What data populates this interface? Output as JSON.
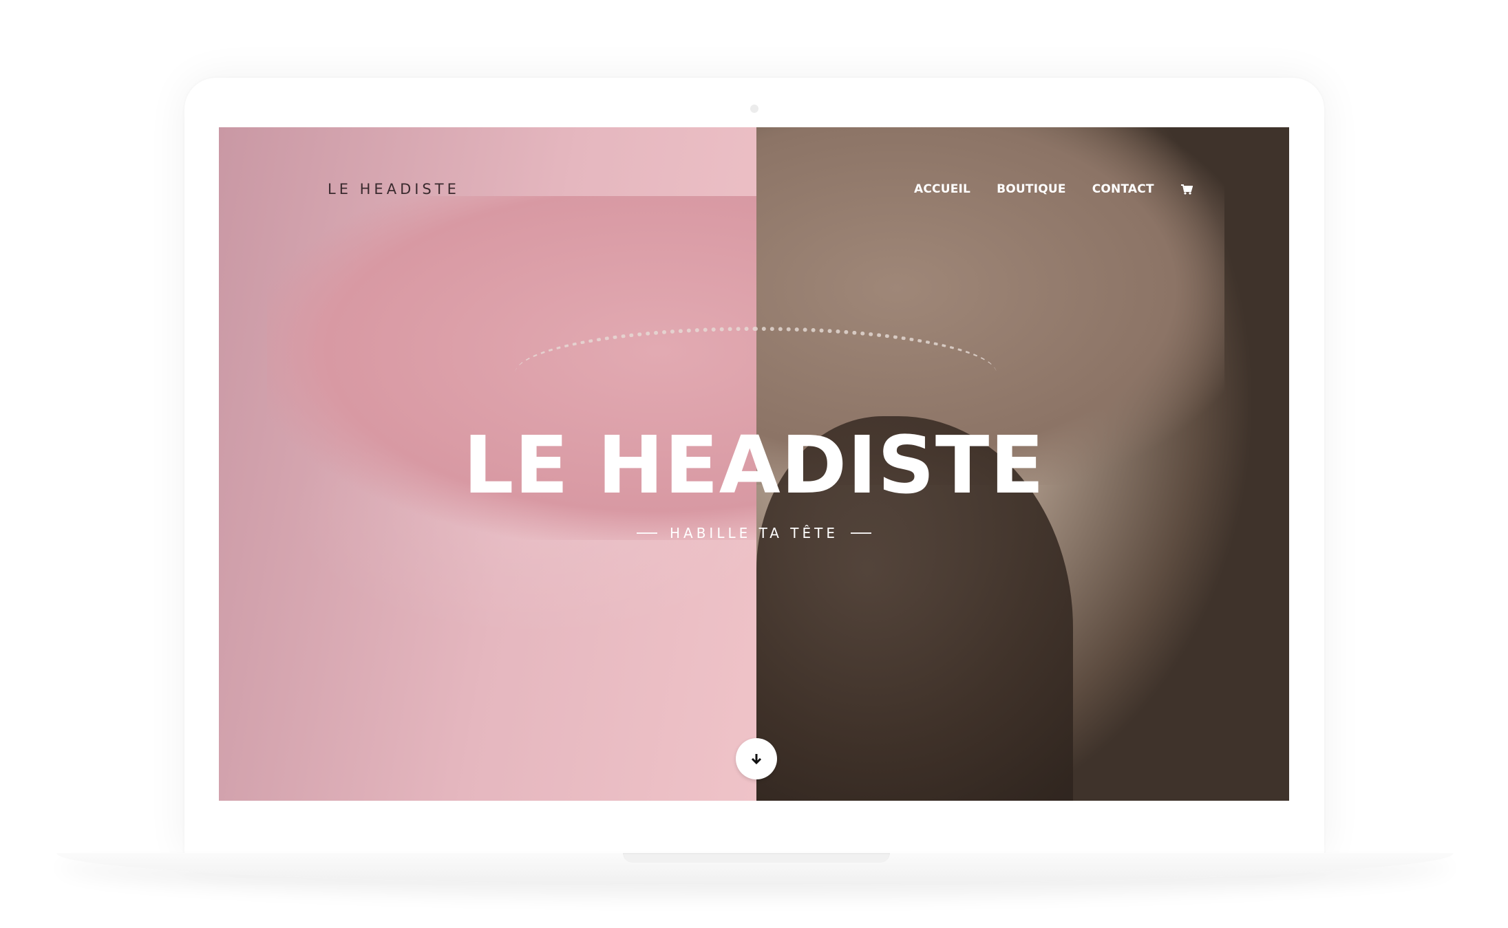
{
  "site": {
    "logo_text": "LE HEADISTE"
  },
  "nav": {
    "items": [
      {
        "label": "ACCUEIL"
      },
      {
        "label": "BOUTIQUE"
      },
      {
        "label": "CONTACT"
      }
    ],
    "cart_icon": "shopping-cart-icon"
  },
  "hero": {
    "title": "LE HEADISTE",
    "subtitle": "HABILLE TA TÊTE",
    "scroll_icon": "arrow-down-icon"
  },
  "colors": {
    "pink_overlay": "#e5b7bf",
    "sepia_tone": "#a28f80",
    "text_light": "#ffffff",
    "logo_dark": "#3a2a2e"
  }
}
